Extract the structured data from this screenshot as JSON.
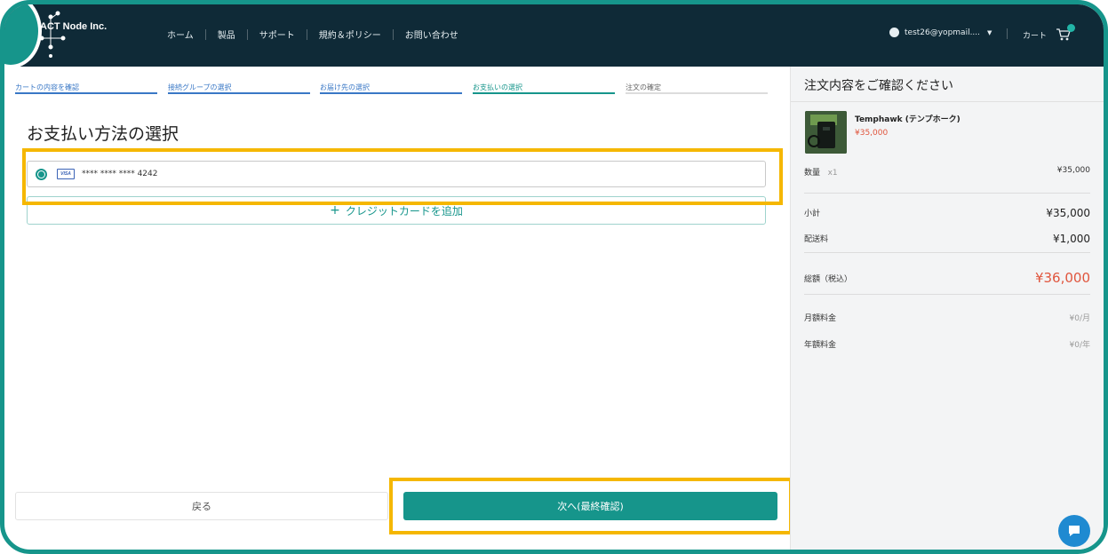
{
  "step_marker": "5",
  "header": {
    "brand": "ACT Node Inc.",
    "nav": [
      "ホーム",
      "製品",
      "サポート",
      "規約＆ポリシー",
      "お問い合わせ"
    ],
    "user_email": "test26@yopmail....",
    "cart_label": "カート"
  },
  "steps": [
    {
      "label": "カートの内容を確認",
      "state": "done"
    },
    {
      "label": "接続グループの選択",
      "state": "done"
    },
    {
      "label": "お届け先の選択",
      "state": "done"
    },
    {
      "label": "お支払いの選択",
      "state": "active"
    },
    {
      "label": "注文の確定",
      "state": "pending"
    }
  ],
  "main": {
    "title": "お支払い方法の選択",
    "card": {
      "brand": "VISA",
      "number": "**** **** **** 4242"
    },
    "add_card_label": "クレジットカードを追加",
    "back_label": "戻る",
    "next_label": "次へ(最終確認)"
  },
  "summary": {
    "title": "注文内容をご確認ください",
    "product_name": "Temphawk (テンプホーク)",
    "product_price": "¥35,000",
    "qty_label": "数量",
    "qty_value": "x1",
    "qty_price": "¥35,000",
    "subtotal_label": "小計",
    "subtotal_value": "¥35,000",
    "shipping_label": "配送料",
    "shipping_value": "¥1,000",
    "total_label": "総額（税込）",
    "total_value": "¥36,000",
    "monthly_label": "月額料金",
    "monthly_value": "¥0/月",
    "yearly_label": "年額料金",
    "yearly_value": "¥0/年"
  },
  "colors": {
    "accent": "#16958b",
    "header_bg": "#0f2a37",
    "highlight": "#f5b700",
    "price": "#e0553d"
  }
}
